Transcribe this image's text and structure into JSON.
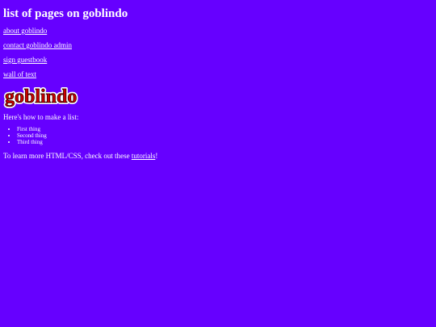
{
  "page": {
    "title": "list of pages on goblindo"
  },
  "links": [
    {
      "label": "about goblindo"
    },
    {
      "label": "contact goblindo admin"
    },
    {
      "label": "sign guestbook"
    },
    {
      "label": "wall of text"
    }
  ],
  "logo": {
    "text": "goblindo",
    "fill_color": "#cc0000",
    "outline_color": "#ffffff"
  },
  "list_section": {
    "intro": "Here's how to make a list:",
    "items": [
      "First thing",
      "Second thing",
      "Third thing"
    ]
  },
  "footer_text": {
    "before": "To learn more HTML/CSS, check out these ",
    "link": "tutorials",
    "after": "!"
  },
  "colors": {
    "background": "#6600ff",
    "text": "#ffffff"
  }
}
